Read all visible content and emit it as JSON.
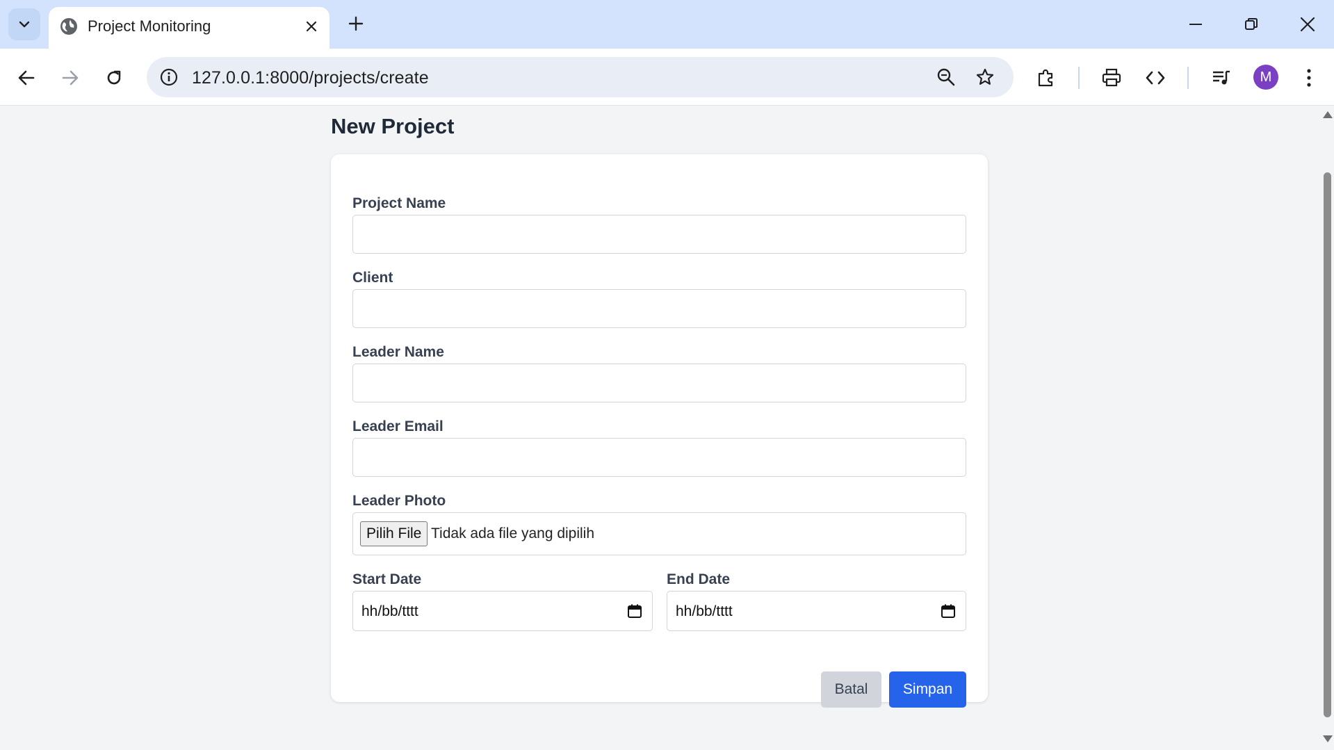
{
  "browser": {
    "tab_title": "Project Monitoring",
    "url": "127.0.0.1:8000/projects/create",
    "profile_initial": "M"
  },
  "page": {
    "title": "New Project"
  },
  "form": {
    "project_name_label": "Project Name",
    "client_label": "Client",
    "leader_name_label": "Leader Name",
    "leader_email_label": "Leader Email",
    "leader_photo_label": "Leader Photo",
    "file_button_label": "Pilih File",
    "file_status": "Tidak ada file yang dipilih",
    "start_date_label": "Start Date",
    "start_date_value": "hh/bb/tttt",
    "end_date_label": "End Date",
    "end_date_value": "hh/bb/tttt",
    "cancel_label": "Batal",
    "save_label": "Simpan"
  },
  "colors": {
    "accent": "#2563eb",
    "cancel_bg": "#d1d5db",
    "page_bg": "#f3f4f6",
    "tabstrip_bg": "#d3e3fd"
  }
}
